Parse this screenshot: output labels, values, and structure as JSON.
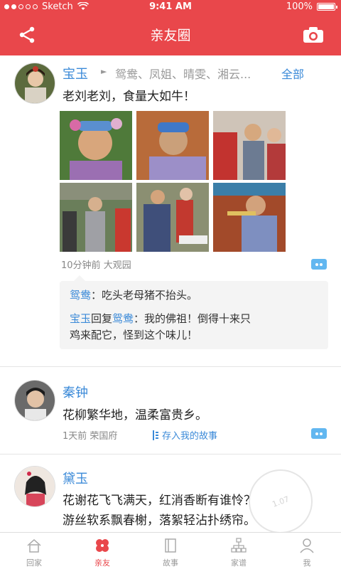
{
  "status_bar": {
    "carrier": "Sketch",
    "time": "9:41 AM",
    "battery": "100%"
  },
  "nav": {
    "title": "亲友圈",
    "share_icon": "share-icon",
    "camera_icon": "camera-icon"
  },
  "posts": [
    {
      "name": "宝玉",
      "mentions": "鸳鸯、凤姐、晴雯、湘云...",
      "mentions_all": "全部",
      "text": "老刘老刘，食量大如牛！",
      "time": "10分钟前",
      "location": "大观园",
      "comments": [
        {
          "author": "鸳鸯",
          "text": "：吃头老母猪不抬头。"
        },
        {
          "author": "宝玉",
          "reply_word": "回复",
          "reply_to": "鸳鸯",
          "text": "：我的佛祖！倒得十来只",
          "text2": "鸡来配它，怪到这个味儿！"
        }
      ]
    },
    {
      "name": "秦钟",
      "text": "花柳繁华地，温柔富贵乡。",
      "time": "1天前",
      "location": "荣国府",
      "save_label": "存入我的故事"
    },
    {
      "name": "黛玉",
      "line1": "花谢花飞飞满天，红消香断有谁怜？",
      "line2": "游丝软系飘春榭，落絮轻沾扑绣帘。"
    }
  ],
  "tabs": [
    {
      "label": "回家",
      "icon": "home-icon"
    },
    {
      "label": "亲友",
      "icon": "friends-icon"
    },
    {
      "label": "故事",
      "icon": "book-icon"
    },
    {
      "label": "家谱",
      "icon": "family-tree-icon"
    },
    {
      "label": "我",
      "icon": "person-icon"
    }
  ],
  "colors": {
    "accent": "#e9474b",
    "link": "#3b8ad8",
    "comment_button": "#62b7f0"
  }
}
